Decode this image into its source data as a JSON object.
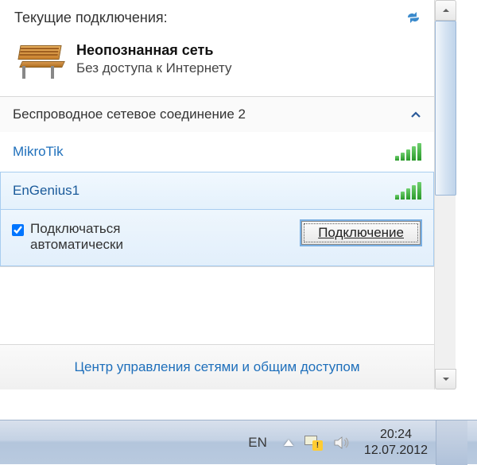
{
  "header": {
    "title": "Текущие подключения:"
  },
  "currentConnection": {
    "name": "Неопознанная сеть",
    "status": "Без доступа к Интернету"
  },
  "wireless": {
    "header": "Беспроводное сетевое соединение 2",
    "networks": [
      {
        "name": "MikroTik"
      },
      {
        "name": "EnGenius1"
      }
    ],
    "autoConnectLabelLine1": "Подключаться",
    "autoConnectLabelLine2": "автоматически",
    "connectButton": "Подключение"
  },
  "footer": {
    "link": "Центр управления сетями и общим доступом"
  },
  "taskbar": {
    "language": "EN",
    "time": "20:24",
    "date": "12.07.2012"
  }
}
